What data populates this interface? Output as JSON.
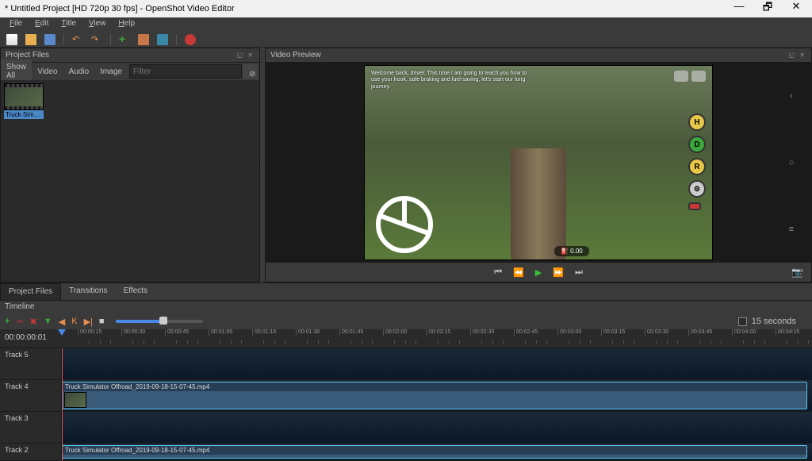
{
  "window": {
    "title": "* Untitled Project [HD 720p 30 fps] - OpenShot Video Editor",
    "min_icon": "—",
    "max_icon": "🗗",
    "close_icon": "✕"
  },
  "menu": {
    "items": [
      "File",
      "Edit",
      "Title",
      "View",
      "Help"
    ]
  },
  "panes": {
    "project_files": "Project Files",
    "video_preview": "Video Preview",
    "timeline": "Timeline"
  },
  "filter": {
    "tabs": [
      "Show All",
      "Video",
      "Audio",
      "Image"
    ],
    "placeholder": "Filter",
    "clear": "⊘"
  },
  "project_item": {
    "label": "Truck Simulator ..."
  },
  "bottom_tabs": {
    "items": [
      "Project Files",
      "Transitions",
      "Effects"
    ]
  },
  "preview": {
    "game_text": "Welcome back, driver. This time I am going to teach you how to use your hook, safe braking and fuel-saving, let's start our long journey.",
    "btn_h": "H",
    "btn_d": "D",
    "btn_r": "R",
    "fuel": "⛽ 0.00"
  },
  "playback": {
    "start": "⏮",
    "rew": "⏪",
    "play": "▶",
    "ff": "⏩",
    "end": "⏭"
  },
  "timeline": {
    "timecode": "00:00:00:01",
    "zoom_label": "15 seconds",
    "ticks": [
      "00:00:15",
      "00:00:30",
      "00:00:45",
      "00:01:00",
      "00:01:15",
      "00:01:30",
      "00:01:45",
      "00:02:00",
      "00:02:15",
      "00:02:30",
      "00:02:45",
      "00:03:00",
      "00:03:15",
      "00:03:30",
      "00:03:45",
      "00:04:00",
      "00:04:15"
    ],
    "tracks": [
      "Track 5",
      "Track 4",
      "Track 3",
      "Track 2"
    ],
    "clip_name": "Truck Simulator Offroad_2019-09-18-15-07-45.mp4"
  },
  "tl_tools": {
    "add": "+",
    "scissors": "✂",
    "close": "✖",
    "marker": "▼",
    "prev": "◀",
    "kf": "K",
    "next": "▶|",
    "center": "■"
  }
}
